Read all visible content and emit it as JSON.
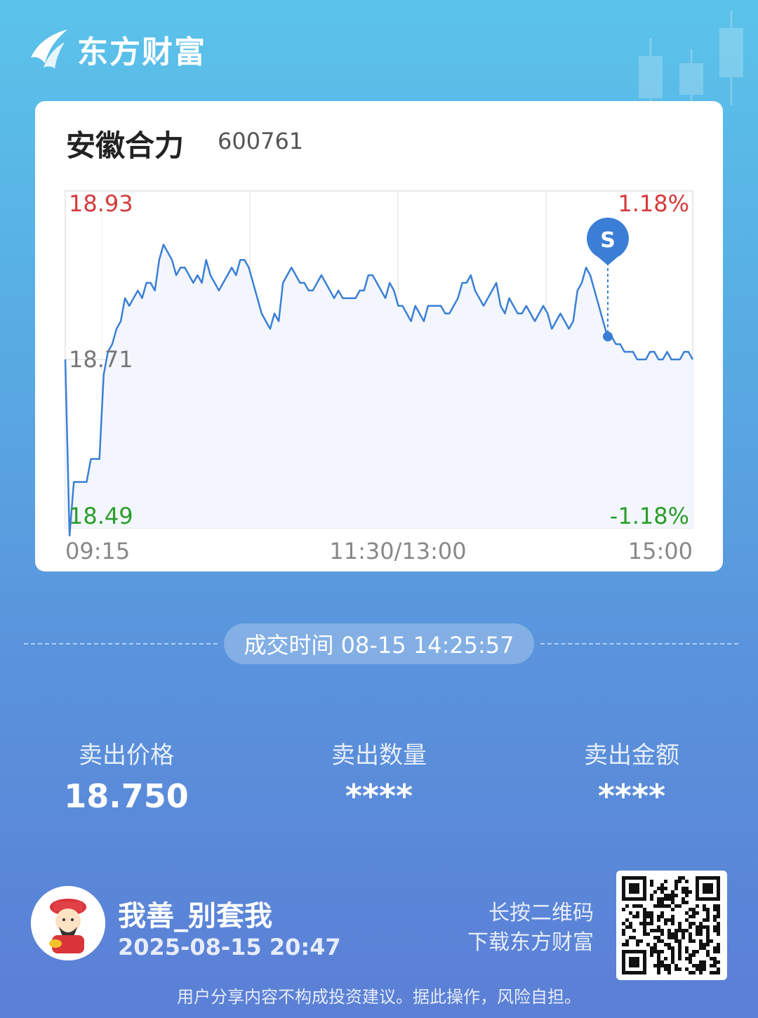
{
  "brand": {
    "name": "东方财富"
  },
  "stock": {
    "name": "安徽合力",
    "code": "600761"
  },
  "chart_data": {
    "type": "line",
    "y_labels": {
      "high": "18.93",
      "mid": "18.71",
      "low": "18.49"
    },
    "pct_labels": {
      "high": "1.18%",
      "low": "-1.18%"
    },
    "x_labels": [
      "09:15",
      "11:30/13:00",
      "15:00"
    ],
    "ylim": [
      18.49,
      18.93
    ],
    "marker": {
      "label": "S",
      "value": 18.74
    },
    "series": [
      {
        "values": [
          18.71,
          18.48,
          18.55,
          18.55,
          18.55,
          18.55,
          18.58,
          18.58,
          18.58,
          18.69,
          18.72,
          18.73,
          18.75,
          18.76,
          18.79,
          18.78,
          18.79,
          18.8,
          18.79,
          18.81,
          18.81,
          18.8,
          18.84,
          18.86,
          18.85,
          18.84,
          18.82,
          18.83,
          18.83,
          18.82,
          18.81,
          18.82,
          18.81,
          18.84,
          18.82,
          18.81,
          18.8,
          18.81,
          18.82,
          18.83,
          18.82,
          18.84,
          18.84,
          18.83,
          18.81,
          18.79,
          18.77,
          18.76,
          18.75,
          18.77,
          18.76,
          18.81,
          18.82,
          18.83,
          18.82,
          18.81,
          18.81,
          18.8,
          18.8,
          18.81,
          18.82,
          18.81,
          18.8,
          18.79,
          18.8,
          18.79,
          18.79,
          18.79,
          18.79,
          18.8,
          18.8,
          18.82,
          18.82,
          18.81,
          18.8,
          18.79,
          18.81,
          18.8,
          18.78,
          18.78,
          18.77,
          18.76,
          18.78,
          18.77,
          18.76,
          18.78,
          18.78,
          18.78,
          18.78,
          18.77,
          18.77,
          18.78,
          18.79,
          18.81,
          18.81,
          18.82,
          18.8,
          18.79,
          18.78,
          18.79,
          18.8,
          18.81,
          18.78,
          18.77,
          18.79,
          18.78,
          18.77,
          18.77,
          18.78,
          18.77,
          18.76,
          18.77,
          18.78,
          18.77,
          18.75,
          18.76,
          18.77,
          18.76,
          18.75,
          18.76,
          18.8,
          18.81,
          18.83,
          18.82,
          18.8,
          18.78,
          18.76,
          18.74,
          18.74,
          18.73,
          18.73,
          18.72,
          18.72,
          18.72,
          18.71,
          18.71,
          18.71,
          18.72,
          18.72,
          18.71,
          18.71,
          18.72,
          18.71,
          18.71,
          18.71,
          18.72,
          18.72,
          18.71
        ]
      }
    ]
  },
  "trade_time": {
    "label": "成交时间 08-15 14:25:57"
  },
  "stats": [
    {
      "label": "卖出价格",
      "value": "18.750"
    },
    {
      "label": "卖出数量",
      "value": "****"
    },
    {
      "label": "卖出金额",
      "value": "****"
    }
  ],
  "user": {
    "name": "我善_别套我",
    "time": "2025-08-15 20:47"
  },
  "qr_hint": {
    "line1": "长按二维码",
    "line2": "下载东方财富"
  },
  "disclaimer": "用户分享内容不构成投资建议。据此操作，风险自担。",
  "colors": {
    "up": "#d63a3a",
    "down": "#2a9d2a",
    "line": "#3a7fd5",
    "marker": "#3a7fd5"
  }
}
